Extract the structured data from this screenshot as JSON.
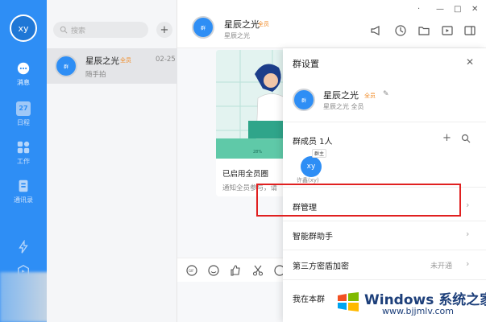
{
  "user": {
    "avatar_text": "xy"
  },
  "rail": {
    "items": [
      {
        "label": "消息",
        "icon": "chat-icon"
      },
      {
        "label": "日程",
        "icon": "calendar-icon",
        "day": "27"
      },
      {
        "label": "工作",
        "icon": "apps-icon"
      },
      {
        "label": "通讯录",
        "icon": "contacts-icon"
      }
    ]
  },
  "search": {
    "placeholder": "搜索"
  },
  "conversations": [
    {
      "name": "星辰之光",
      "badge": "全员",
      "time": "02-25",
      "last_message": "随手拍",
      "avatar_text": "群"
    }
  ],
  "chat": {
    "title": "星辰之光",
    "badge": "全员",
    "subtitle": "星辰之光",
    "avatar_text": "群",
    "window_controls": [
      "·",
      "—",
      "□",
      "✕"
    ],
    "card": {
      "title": "已启用全员圈",
      "desc": "通知全员参与，请",
      "progress_label": "28%"
    }
  },
  "panel": {
    "title": "群设置",
    "close": "✕",
    "group_name": "星辰之光",
    "group_badge": "全员",
    "group_sub": "星辰之光 全员",
    "group_avatar_text": "群",
    "edit_icon": "✎",
    "members_title": "群成员 1人",
    "member": {
      "avatar_text": "xy",
      "tag": "群主",
      "name": "许鑫(xy)"
    },
    "menu": [
      {
        "label": "群管理",
        "value": ""
      },
      {
        "label": "智能群助手",
        "value": ""
      },
      {
        "label": "第三方密盾加密",
        "value": "未开通"
      },
      {
        "label": "我在本群",
        "value": ""
      }
    ]
  },
  "watermark": {
    "title": "Windows 系统之家",
    "url": "www.bjjmlv.com"
  },
  "colors": {
    "accent": "#2e8ef5",
    "badge": "#f08a24",
    "highlight": "#e02020"
  }
}
